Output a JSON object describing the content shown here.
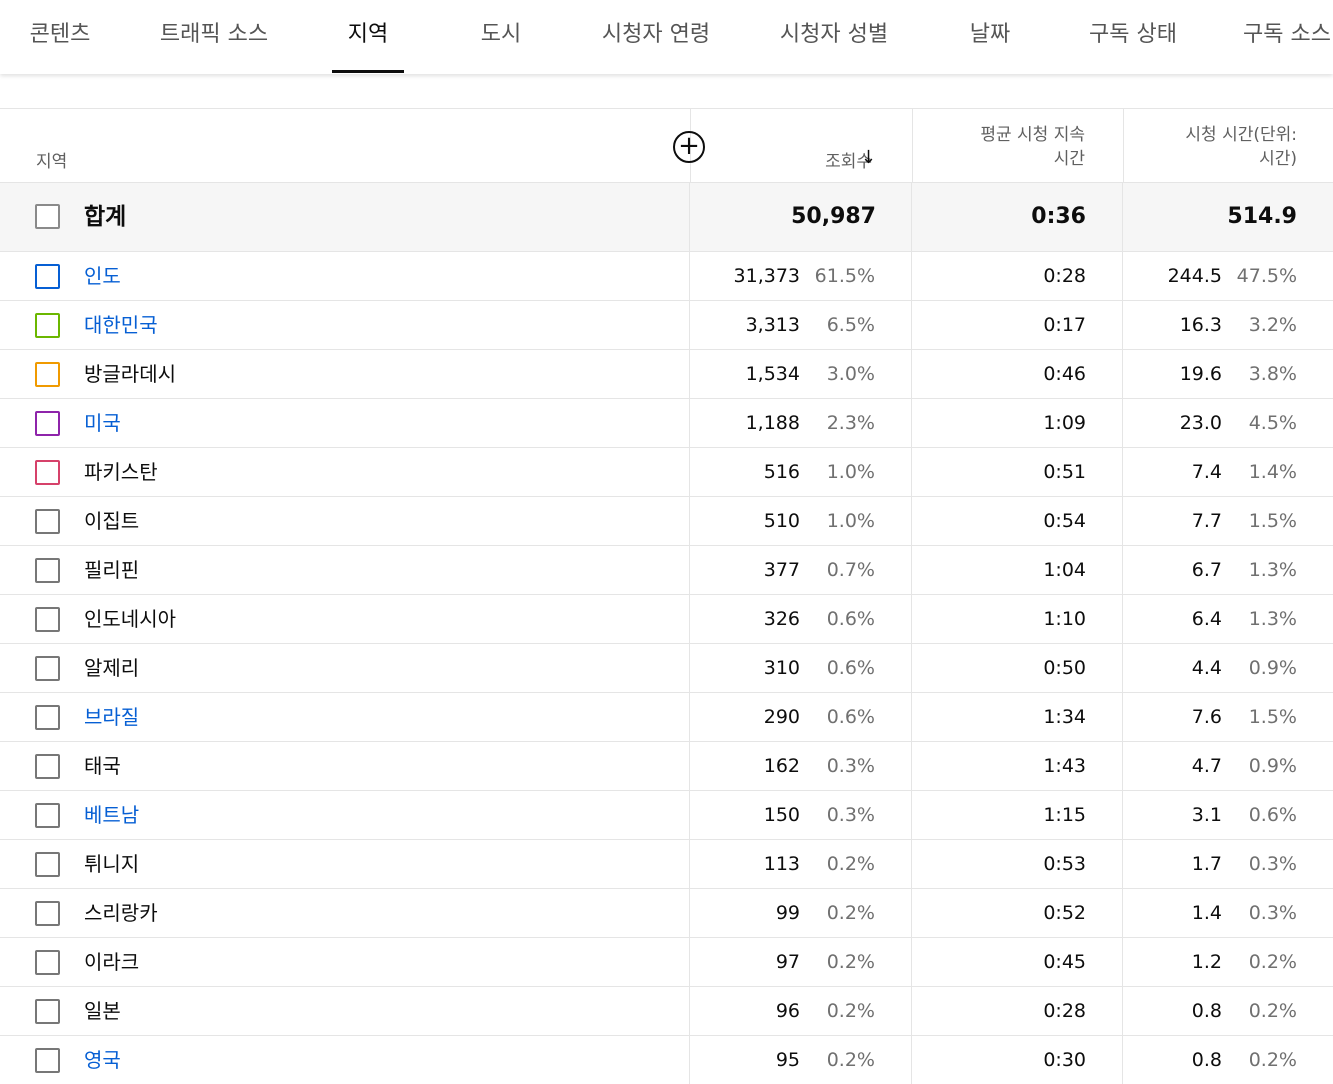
{
  "tabs": [
    {
      "label": "콘텐츠"
    },
    {
      "label": "트래픽 소스"
    },
    {
      "label": "지역"
    },
    {
      "label": "도시"
    },
    {
      "label": "시청자 연령"
    },
    {
      "label": "시청자 성별"
    },
    {
      "label": "날짜"
    },
    {
      "label": "구독 상태"
    },
    {
      "label": "구독 소스"
    }
  ],
  "active_tab": "지역",
  "table": {
    "headers": {
      "region": "지역",
      "add_icon": "plus-circle-icon",
      "views": "조회수",
      "sort_icon": "arrow-down-icon",
      "avg_duration_line1": "평균 시청 지속",
      "avg_duration_line2": "시간",
      "watch_time_line1": "시청 시간(단위:",
      "watch_time_line2": "시간)"
    },
    "total": {
      "label": "합계",
      "views": "50,987",
      "avg_duration": "0:36",
      "watch_time": "514.9"
    },
    "rows": [
      {
        "name": "인도",
        "link": true,
        "checkbox_color": "#065fd4",
        "views": "31,373",
        "views_pct": "61.5%",
        "avg": "0:28",
        "watch": "244.5",
        "watch_pct": "47.5%"
      },
      {
        "name": "대한민국",
        "link": true,
        "checkbox_color": "#6bb700",
        "views": "3,313",
        "views_pct": "6.5%",
        "avg": "0:17",
        "watch": "16.3",
        "watch_pct": "3.2%"
      },
      {
        "name": "방글라데시",
        "link": false,
        "checkbox_color": "#f09a00",
        "views": "1,534",
        "views_pct": "3.0%",
        "avg": "0:46",
        "watch": "19.6",
        "watch_pct": "3.8%"
      },
      {
        "name": "미국",
        "link": true,
        "checkbox_color": "#8e24aa",
        "views": "1,188",
        "views_pct": "2.3%",
        "avg": "1:09",
        "watch": "23.0",
        "watch_pct": "4.5%"
      },
      {
        "name": "파키스탄",
        "link": false,
        "checkbox_color": "#d6416a",
        "views": "516",
        "views_pct": "1.0%",
        "avg": "0:51",
        "watch": "7.4",
        "watch_pct": "1.4%"
      },
      {
        "name": "이집트",
        "link": false,
        "checkbox_color": "",
        "views": "510",
        "views_pct": "1.0%",
        "avg": "0:54",
        "watch": "7.7",
        "watch_pct": "1.5%"
      },
      {
        "name": "필리핀",
        "link": false,
        "checkbox_color": "",
        "views": "377",
        "views_pct": "0.7%",
        "avg": "1:04",
        "watch": "6.7",
        "watch_pct": "1.3%"
      },
      {
        "name": "인도네시아",
        "link": false,
        "checkbox_color": "",
        "views": "326",
        "views_pct": "0.6%",
        "avg": "1:10",
        "watch": "6.4",
        "watch_pct": "1.3%"
      },
      {
        "name": "알제리",
        "link": false,
        "checkbox_color": "",
        "views": "310",
        "views_pct": "0.6%",
        "avg": "0:50",
        "watch": "4.4",
        "watch_pct": "0.9%"
      },
      {
        "name": "브라질",
        "link": true,
        "checkbox_color": "",
        "views": "290",
        "views_pct": "0.6%",
        "avg": "1:34",
        "watch": "7.6",
        "watch_pct": "1.5%"
      },
      {
        "name": "태국",
        "link": false,
        "checkbox_color": "",
        "views": "162",
        "views_pct": "0.3%",
        "avg": "1:43",
        "watch": "4.7",
        "watch_pct": "0.9%"
      },
      {
        "name": "베트남",
        "link": true,
        "checkbox_color": "",
        "views": "150",
        "views_pct": "0.3%",
        "avg": "1:15",
        "watch": "3.1",
        "watch_pct": "0.6%"
      },
      {
        "name": "튀니지",
        "link": false,
        "checkbox_color": "",
        "views": "113",
        "views_pct": "0.2%",
        "avg": "0:53",
        "watch": "1.7",
        "watch_pct": "0.3%"
      },
      {
        "name": "스리랑카",
        "link": false,
        "checkbox_color": "",
        "views": "99",
        "views_pct": "0.2%",
        "avg": "0:52",
        "watch": "1.4",
        "watch_pct": "0.3%"
      },
      {
        "name": "이라크",
        "link": false,
        "checkbox_color": "",
        "views": "97",
        "views_pct": "0.2%",
        "avg": "0:45",
        "watch": "1.2",
        "watch_pct": "0.2%"
      },
      {
        "name": "일본",
        "link": false,
        "checkbox_color": "",
        "views": "96",
        "views_pct": "0.2%",
        "avg": "0:28",
        "watch": "0.8",
        "watch_pct": "0.2%"
      },
      {
        "name": "영국",
        "link": true,
        "checkbox_color": "",
        "views": "95",
        "views_pct": "0.2%",
        "avg": "0:30",
        "watch": "0.8",
        "watch_pct": "0.2%"
      }
    ]
  }
}
